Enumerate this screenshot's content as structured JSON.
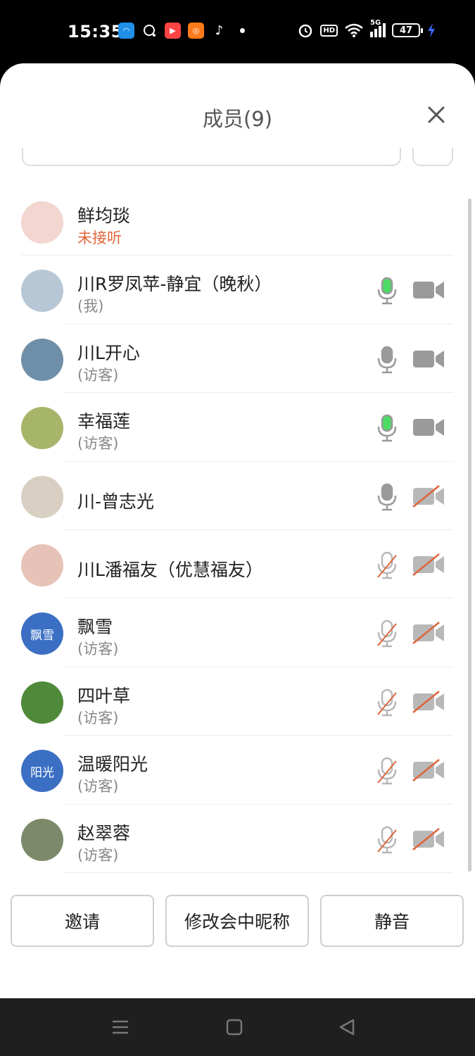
{
  "status_bar": {
    "time": "15:35",
    "network": "5G",
    "battery": "47",
    "hd_label": "HD"
  },
  "sheet": {
    "title": "成员(9)"
  },
  "members": [
    {
      "name": "鲜均琰",
      "sub": "未接听",
      "sub_style": "red",
      "mic": "none",
      "cam": "none",
      "avatar_text": "",
      "avatar_color": "#f3d6cf"
    },
    {
      "name": "川R罗凤苹-静宜（晚秋）",
      "sub": "(我)",
      "sub_style": "gray",
      "mic": "active",
      "cam": "on",
      "avatar_text": "",
      "avatar_color": "#b7c7d6"
    },
    {
      "name": "川L开心",
      "sub": "(访客)",
      "sub_style": "gray",
      "mic": "on",
      "cam": "on",
      "avatar_text": "",
      "avatar_color": "#6f8fa8"
    },
    {
      "name": "幸福莲",
      "sub": "(访客)",
      "sub_style": "gray",
      "mic": "active",
      "cam": "on",
      "avatar_text": "",
      "avatar_color": "#a7b56a"
    },
    {
      "name": "川-曾志光",
      "sub": "",
      "sub_style": "gray",
      "mic": "on",
      "cam": "off",
      "avatar_text": "",
      "avatar_color": "#d8cfc2"
    },
    {
      "name": "川L潘福友（优慧福友）",
      "sub": "",
      "sub_style": "gray",
      "mic": "off",
      "cam": "off",
      "avatar_text": "",
      "avatar_color": "#e7c2b6"
    },
    {
      "name": "飘雪",
      "sub": "(访客)",
      "sub_style": "gray",
      "mic": "off",
      "cam": "off",
      "avatar_text": "飘雪",
      "avatar_color": "#3a6fc4"
    },
    {
      "name": "四叶草",
      "sub": "(访客)",
      "sub_style": "gray",
      "mic": "off",
      "cam": "off",
      "avatar_text": "",
      "avatar_color": "#4f8a3a"
    },
    {
      "name": "温暖阳光",
      "sub": "(访客)",
      "sub_style": "gray",
      "mic": "off",
      "cam": "off",
      "avatar_text": "阳光",
      "avatar_color": "#3a6fc4"
    },
    {
      "name": "赵翠蓉",
      "sub": "(访客)",
      "sub_style": "gray",
      "mic": "off",
      "cam": "off",
      "avatar_text": "",
      "avatar_color": "#7c8a6a"
    }
  ],
  "buttons": {
    "invite": "邀请",
    "rename": "修改会中昵称",
    "mute": "静音"
  },
  "colors": {
    "icon_gray": "#9a9a9a",
    "mic_active": "#4cd964",
    "off_slash": "#e0643a"
  }
}
